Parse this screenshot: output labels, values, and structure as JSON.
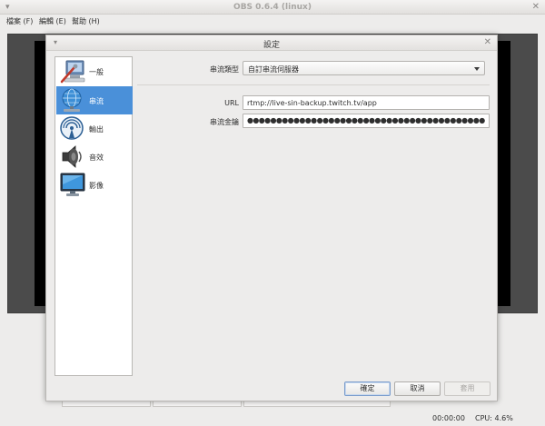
{
  "window": {
    "title": "OBS 0.6.4 (linux)",
    "menu": [
      {
        "label": "檔案 (F)"
      },
      {
        "label": "編輯 (E)"
      },
      {
        "label": "幫助 (H)"
      }
    ]
  },
  "statusbar": {
    "time": "00:00:00",
    "cpu": "CPU: 4.6%"
  },
  "dialog": {
    "title": "設定",
    "categories": [
      {
        "label": "一般",
        "icon": "general-settings-icon",
        "selected": false
      },
      {
        "label": "串流",
        "icon": "network-globe-icon",
        "selected": true
      },
      {
        "label": "輸出",
        "icon": "broadcast-output-icon",
        "selected": false
      },
      {
        "label": "音效",
        "icon": "speaker-icon",
        "selected": false
      },
      {
        "label": "影像",
        "icon": "monitor-icon",
        "selected": false
      }
    ],
    "stream": {
      "type_label": "串流類型",
      "type_value": "自訂串流伺服器",
      "url_label": "URL",
      "url_value": "rtmp://live-sin-backup.twitch.tv/app",
      "key_label": "串流金鑰",
      "key_value": "●●●●●●●●●●●●●●●●●●●●●●●●●●●●●●●●●●●●●●●●●●●●●●●●"
    },
    "buttons": {
      "ok": "確定",
      "cancel": "取消",
      "apply": "套用"
    }
  }
}
